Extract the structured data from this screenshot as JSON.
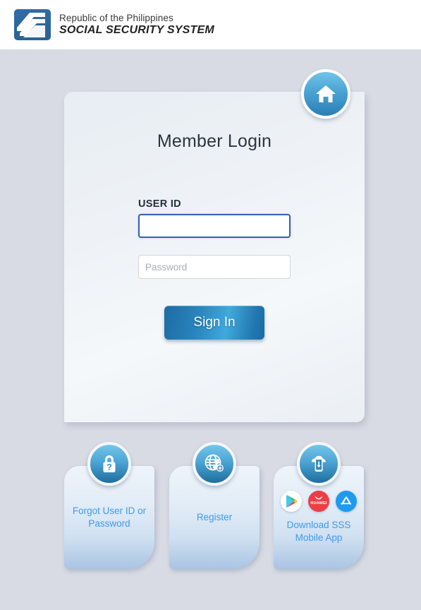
{
  "header": {
    "logo_icon": "sss-logo-icon",
    "line1": "Republic of the Philippines",
    "line2": "SOCIAL SECURITY SYSTEM"
  },
  "home_button": {
    "icon": "home-icon",
    "aria_label": "Home"
  },
  "login": {
    "title": "Member Login",
    "userid": {
      "label": "USER ID",
      "value": "",
      "placeholder": ""
    },
    "password": {
      "value": "",
      "placeholder": "Password"
    },
    "signin_label": "Sign In"
  },
  "bottom_cards": [
    {
      "icon": "lock-question-icon",
      "label": "Forgot User ID or Password"
    },
    {
      "icon": "globe-add-user-icon",
      "label": "Register"
    },
    {
      "icon": "mobile-download-cloud-icon",
      "label": "Download SSS Mobile App",
      "stores": [
        {
          "name": "google-play-icon",
          "title": "Google Play"
        },
        {
          "name": "huawei-appgallery-icon",
          "title": "HUAWEI",
          "text": "HUAWEI"
        },
        {
          "name": "apple-app-store-icon",
          "title": "App Store"
        }
      ]
    }
  ],
  "colors": {
    "page_background": "#d8dbe4",
    "header_background": "#ffffff",
    "brand_blue": "#2e6da4",
    "link_blue": "#3f9ae8",
    "accent_cyan": "#4ca4d4",
    "title_text": "#2b3644",
    "focus_border": "#3b5fb5"
  }
}
